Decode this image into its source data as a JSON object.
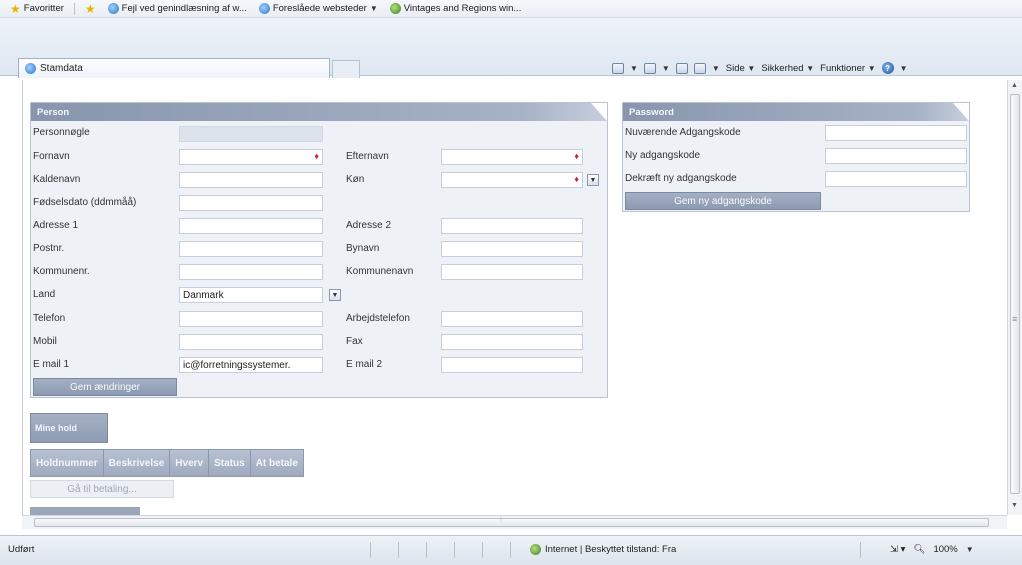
{
  "favorites_bar": {
    "favorites_label": "Favoritter",
    "items": [
      {
        "label": "Fejl ved genindlæsning af w...",
        "icon": "ie-icon"
      },
      {
        "label": "Foreslåede websteder",
        "icon": "ie-icon"
      },
      {
        "label": "Vintages and Regions win...",
        "icon": "globe-icon"
      }
    ]
  },
  "tab": {
    "title": "Stamdata"
  },
  "command_bar": {
    "page_label": "Side",
    "safety_label": "Sikkerhed",
    "tools_label": "Funktioner"
  },
  "person_panel": {
    "title": "Person",
    "fields": {
      "personnogle": {
        "label": "Personnøgle",
        "value": ""
      },
      "fornavn": {
        "label": "Fornavn",
        "value": ""
      },
      "efternavn": {
        "label": "Efternavn",
        "value": ""
      },
      "kaldenavn": {
        "label": "Kaldenavn",
        "value": ""
      },
      "kon": {
        "label": "Køn",
        "value": ""
      },
      "fodselsdato": {
        "label": "Fødselsdato (ddmmåå)",
        "value": ""
      },
      "adresse1": {
        "label": "Adresse 1",
        "value": ""
      },
      "adresse2": {
        "label": "Adresse 2",
        "value": ""
      },
      "postnr": {
        "label": "Postnr.",
        "value": ""
      },
      "bynavn": {
        "label": "Bynavn",
        "value": ""
      },
      "kommunenr": {
        "label": "Kommunenr.",
        "value": ""
      },
      "kommunenavn": {
        "label": "Kommunenavn",
        "value": ""
      },
      "land": {
        "label": "Land",
        "value": "Danmark"
      },
      "telefon": {
        "label": "Telefon",
        "value": ""
      },
      "arbejdstelefon": {
        "label": "Arbejdstelefon",
        "value": ""
      },
      "mobil": {
        "label": "Mobil",
        "value": ""
      },
      "fax": {
        "label": "Fax",
        "value": ""
      },
      "email1": {
        "label": "E mail 1",
        "value": "ic@forretningssystemer."
      },
      "email2": {
        "label": "E mail 2",
        "value": ""
      }
    },
    "save_button": "Gem ændringer"
  },
  "password_panel": {
    "title": "Password",
    "current_label": "Nuværende Adgangskode",
    "new_label": "Ny adgangskode",
    "confirm_label": "Dekræft ny adgangskode",
    "save_button": "Gem ny adgangskode"
  },
  "holds": {
    "title": "Mine hold",
    "columns": [
      "Holdnummer",
      "Beskrivelse",
      "Hverv",
      "Status",
      "At betale"
    ],
    "pay_button": "Gå til betaling..."
  },
  "status_bar": {
    "text": "Udført",
    "zone": "Internet | Beskyttet tilstand: Fra",
    "zoom": "100%"
  },
  "colors": {
    "panel_header": "#8896ad",
    "panel_bg": "#eef1f6",
    "required_marker": "#c8283a",
    "button": "#8c9ab1"
  }
}
